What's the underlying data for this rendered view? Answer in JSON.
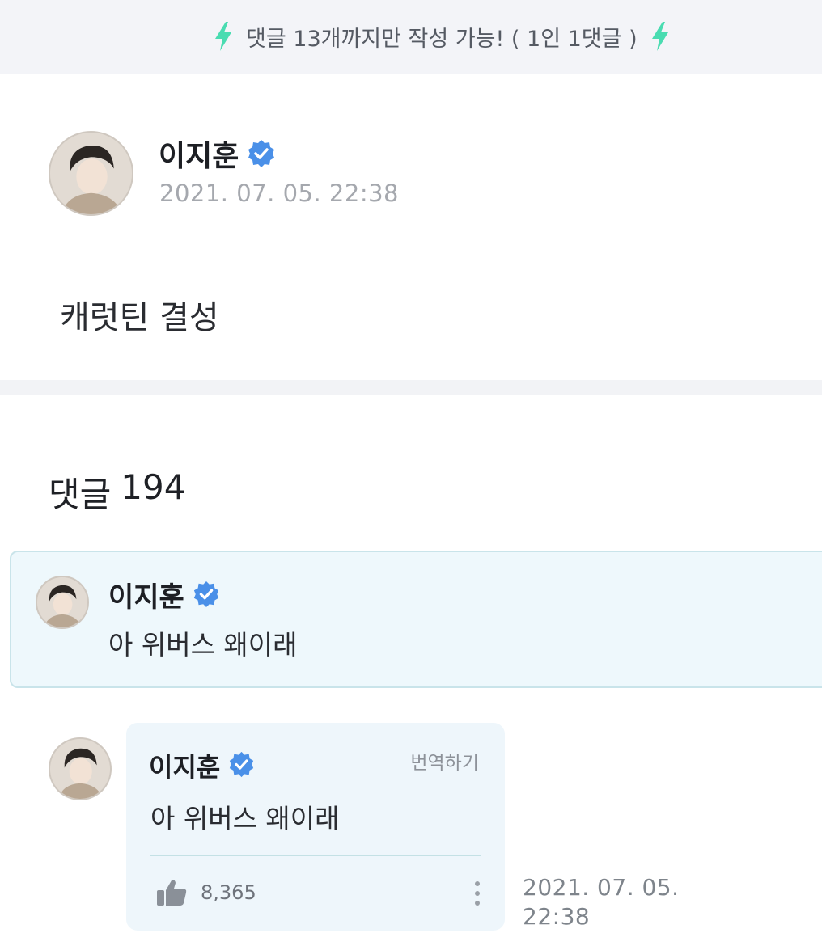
{
  "notice": {
    "text": "댓글 13개까지만 작성 가능! ( 1인 1댓글 )",
    "icon": "lightning-icon",
    "icon_color": "#49dcb1"
  },
  "post": {
    "author": "이지훈",
    "date": "2021. 07. 05. 22:38",
    "body": "캐럿틴 결성",
    "verified_icon": "verified-badge-icon",
    "verified_color": "#4a90e8"
  },
  "comments": {
    "label": "댓글",
    "count": "194",
    "pinned": {
      "author": "이지훈",
      "text": "아 위버스 왜이래"
    },
    "reply": {
      "author": "이지훈",
      "text": "아 위버스 왜이래",
      "translate_label": "번역하기",
      "likes": "8,365",
      "date_line1": "2021. 07. 05.",
      "date_line2": "22:38"
    }
  }
}
